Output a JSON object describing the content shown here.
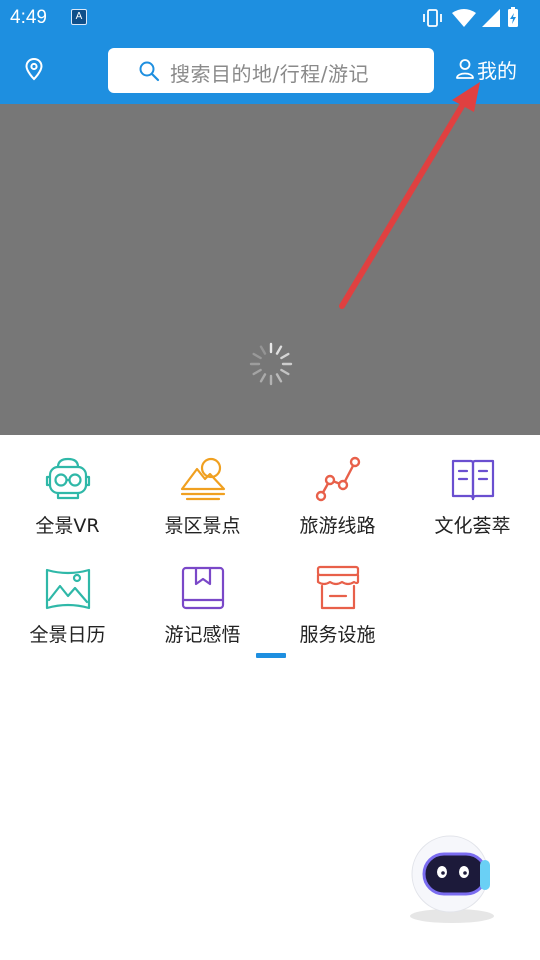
{
  "status_bar": {
    "time": "4:49",
    "notification_icon": "A"
  },
  "header": {
    "location_icon": "location-pin-icon",
    "search_placeholder": "搜索目的地/行程/游记",
    "mine_label": "我的"
  },
  "categories": [
    {
      "label": "全景VR",
      "icon": "vr-headset-icon",
      "color": "#2fb8a8"
    },
    {
      "label": "景区景点",
      "icon": "mountain-icon",
      "color": "#f0a020"
    },
    {
      "label": "旅游线路",
      "icon": "route-icon",
      "color": "#e8604a"
    },
    {
      "label": "文化荟萃",
      "icon": "open-book-icon",
      "color": "#6a4fd0"
    },
    {
      "label": "全景日历",
      "icon": "panorama-icon",
      "color": "#2fb8a8"
    },
    {
      "label": "游记感悟",
      "icon": "bookmark-book-icon",
      "color": "#7a48c8"
    },
    {
      "label": "服务设施",
      "icon": "store-icon",
      "color": "#e8604a"
    }
  ],
  "colors": {
    "brand": "#1e8fe0",
    "banner": "#777777",
    "annotation_arrow": "#e04040"
  }
}
